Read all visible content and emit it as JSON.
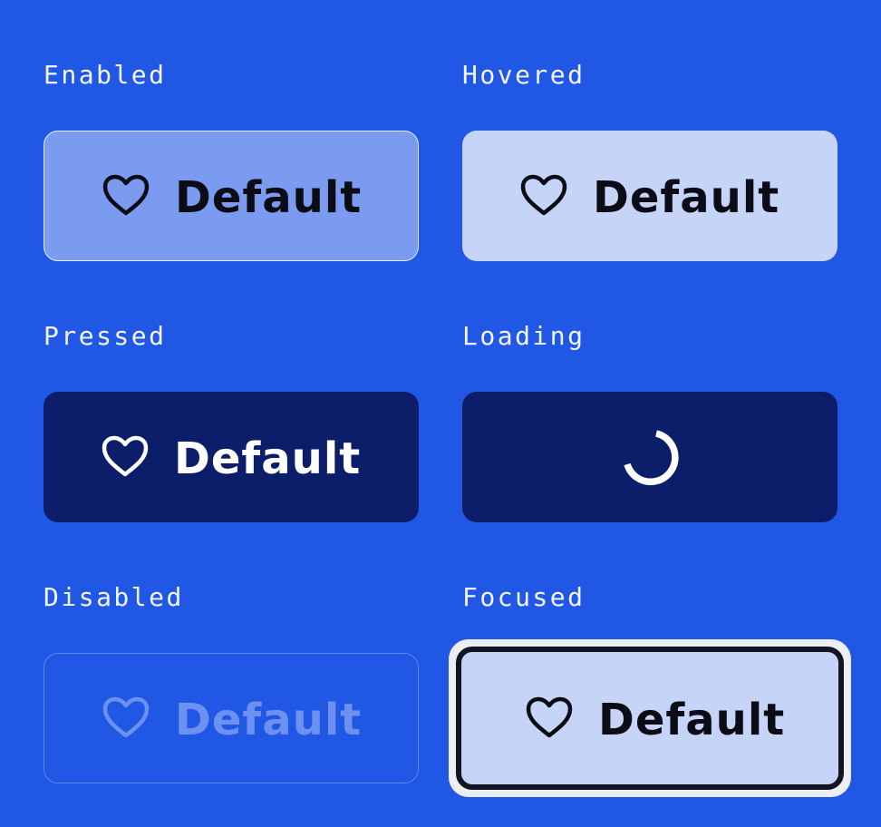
{
  "states": {
    "enabled": {
      "title": "Enabled",
      "button_label": "Default",
      "icon": "heart-icon"
    },
    "hovered": {
      "title": "Hovered",
      "button_label": "Default",
      "icon": "heart-icon"
    },
    "pressed": {
      "title": "Pressed",
      "button_label": "Default",
      "icon": "heart-icon"
    },
    "loading": {
      "title": "Loading",
      "icon": "spinner-icon"
    },
    "disabled": {
      "title": "Disabled",
      "button_label": "Default",
      "icon": "heart-icon"
    },
    "focused": {
      "title": "Focused",
      "button_label": "Default",
      "icon": "heart-icon"
    }
  },
  "colors": {
    "page_background": "#2057e4",
    "enabled_fill": "#7b9bf1",
    "hovered_fill": "#c6d4f8",
    "pressed_fill": "#0c1e6a",
    "loading_fill": "#0c1e6a",
    "disabled_border": "#5f86ee",
    "focused_fill": "#c6d4f8",
    "focus_ring": "#eceef3",
    "focus_outline": "#11151f"
  }
}
